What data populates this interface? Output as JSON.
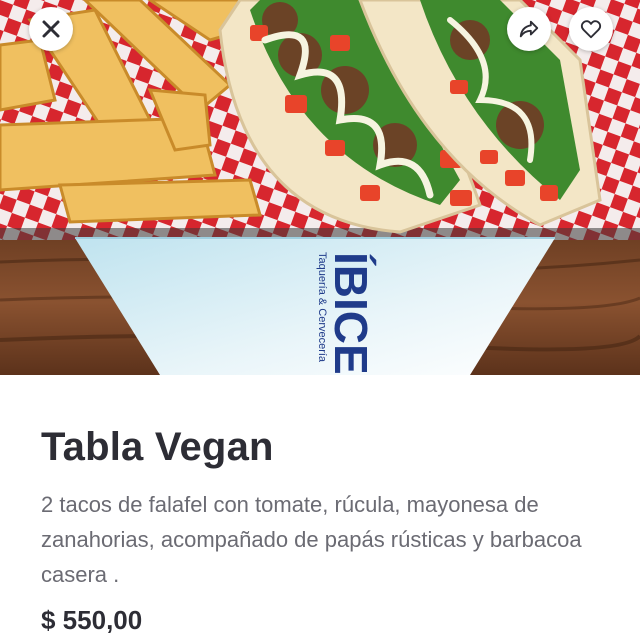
{
  "header": {
    "close_icon": "close-icon",
    "share_icon": "share-icon",
    "favorite_icon": "heart-icon"
  },
  "hero": {
    "napkin_logo": "ÍBICE",
    "napkin_subtitle": "Taquería & Cervecería"
  },
  "product": {
    "title": "Tabla Vegan",
    "description": "2 tacos de falafel con tomate, rúcula, mayonesa de zanahorias, acompañado de papás rústicas y barbacoa casera .",
    "price": "$ 550,00"
  },
  "colors": {
    "title_text": "#2d2d35",
    "body_text": "#6b6b73",
    "button_bg": "#ffffff",
    "napkin_logo": "#1f3b8a"
  }
}
